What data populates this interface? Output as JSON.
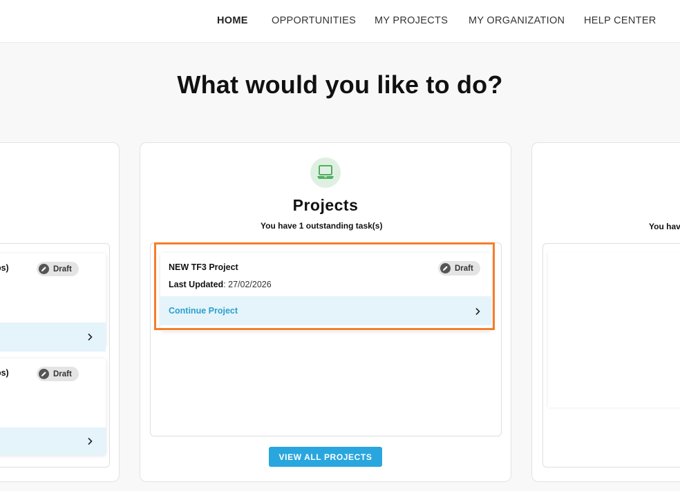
{
  "nav": {
    "items": [
      {
        "label": "HOME",
        "active": true
      },
      {
        "label": "OPPORTUNITIES",
        "active": false
      },
      {
        "label": "MY PROJECTS",
        "active": false
      },
      {
        "label": "MY ORGANIZATION",
        "active": false
      },
      {
        "label": "HELP CENTER",
        "active": false
      }
    ]
  },
  "hero": {
    "title": "What would you like to do?"
  },
  "left_panel": {
    "tasks": [
      {
        "title_fragment": "vos)",
        "status": "Draft"
      },
      {
        "title_fragment": "vos)",
        "status": "Draft"
      }
    ]
  },
  "projects_panel": {
    "icon": "laptop-icon",
    "title": "Projects",
    "outstanding": "You have 1 outstanding task(s)",
    "task": {
      "title": "NEW TF3 Project",
      "status": "Draft",
      "updated_label": "Last Updated",
      "updated_value": ": 27/02/2026",
      "continue_label": "Continue Project"
    },
    "view_all_label": "VIEW ALL PROJECTS"
  },
  "right_panel": {
    "outstanding_fragment": "You hav"
  },
  "colors": {
    "accent_blue": "#2aa6de",
    "continue_text": "#2a9fd0",
    "continue_bg": "#e5f4fa",
    "highlight": "#f57d2a",
    "icon_green": "#4fae5d",
    "icon_bg": "#dff0e3"
  }
}
